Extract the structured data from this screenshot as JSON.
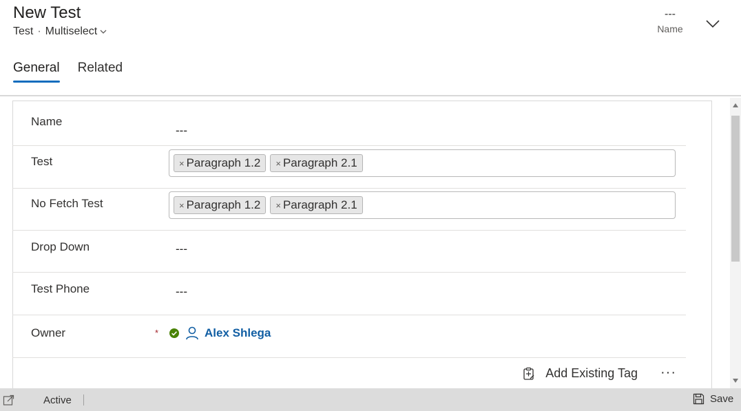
{
  "header": {
    "title": "New Test",
    "entity": "Test",
    "separator": "·",
    "form_selector": "Multiselect",
    "field_value": "---",
    "field_label": "Name"
  },
  "tabs": [
    {
      "label": "General",
      "active": true
    },
    {
      "label": "Related",
      "active": false
    }
  ],
  "form": {
    "name": {
      "label": "Name",
      "value": "---"
    },
    "test": {
      "label": "Test",
      "tags": [
        "Paragraph 1.2",
        "Paragraph 2.1"
      ]
    },
    "no_fetch_test": {
      "label": "No Fetch Test",
      "tags": [
        "Paragraph 1.2",
        "Paragraph 2.1"
      ]
    },
    "drop_down": {
      "label": "Drop Down",
      "value": "---"
    },
    "test_phone": {
      "label": "Test Phone",
      "value": "---"
    },
    "owner": {
      "label": "Owner",
      "required_marker": "*",
      "value": "Alex Shlega"
    },
    "tag_remove_glyph": "×"
  },
  "subgrid": {
    "add_existing_label": "Add Existing Tag",
    "more_label": "···"
  },
  "status": {
    "state": "Active",
    "save_label": "Save"
  },
  "colors": {
    "accent": "#0f6cbd",
    "link": "#115ea3",
    "presence": "#498205"
  },
  "icons": [
    "chevron-down-icon",
    "person-icon",
    "presence-available-icon",
    "clipboard-add-icon",
    "open-in-new-window-icon",
    "save-icon"
  ]
}
